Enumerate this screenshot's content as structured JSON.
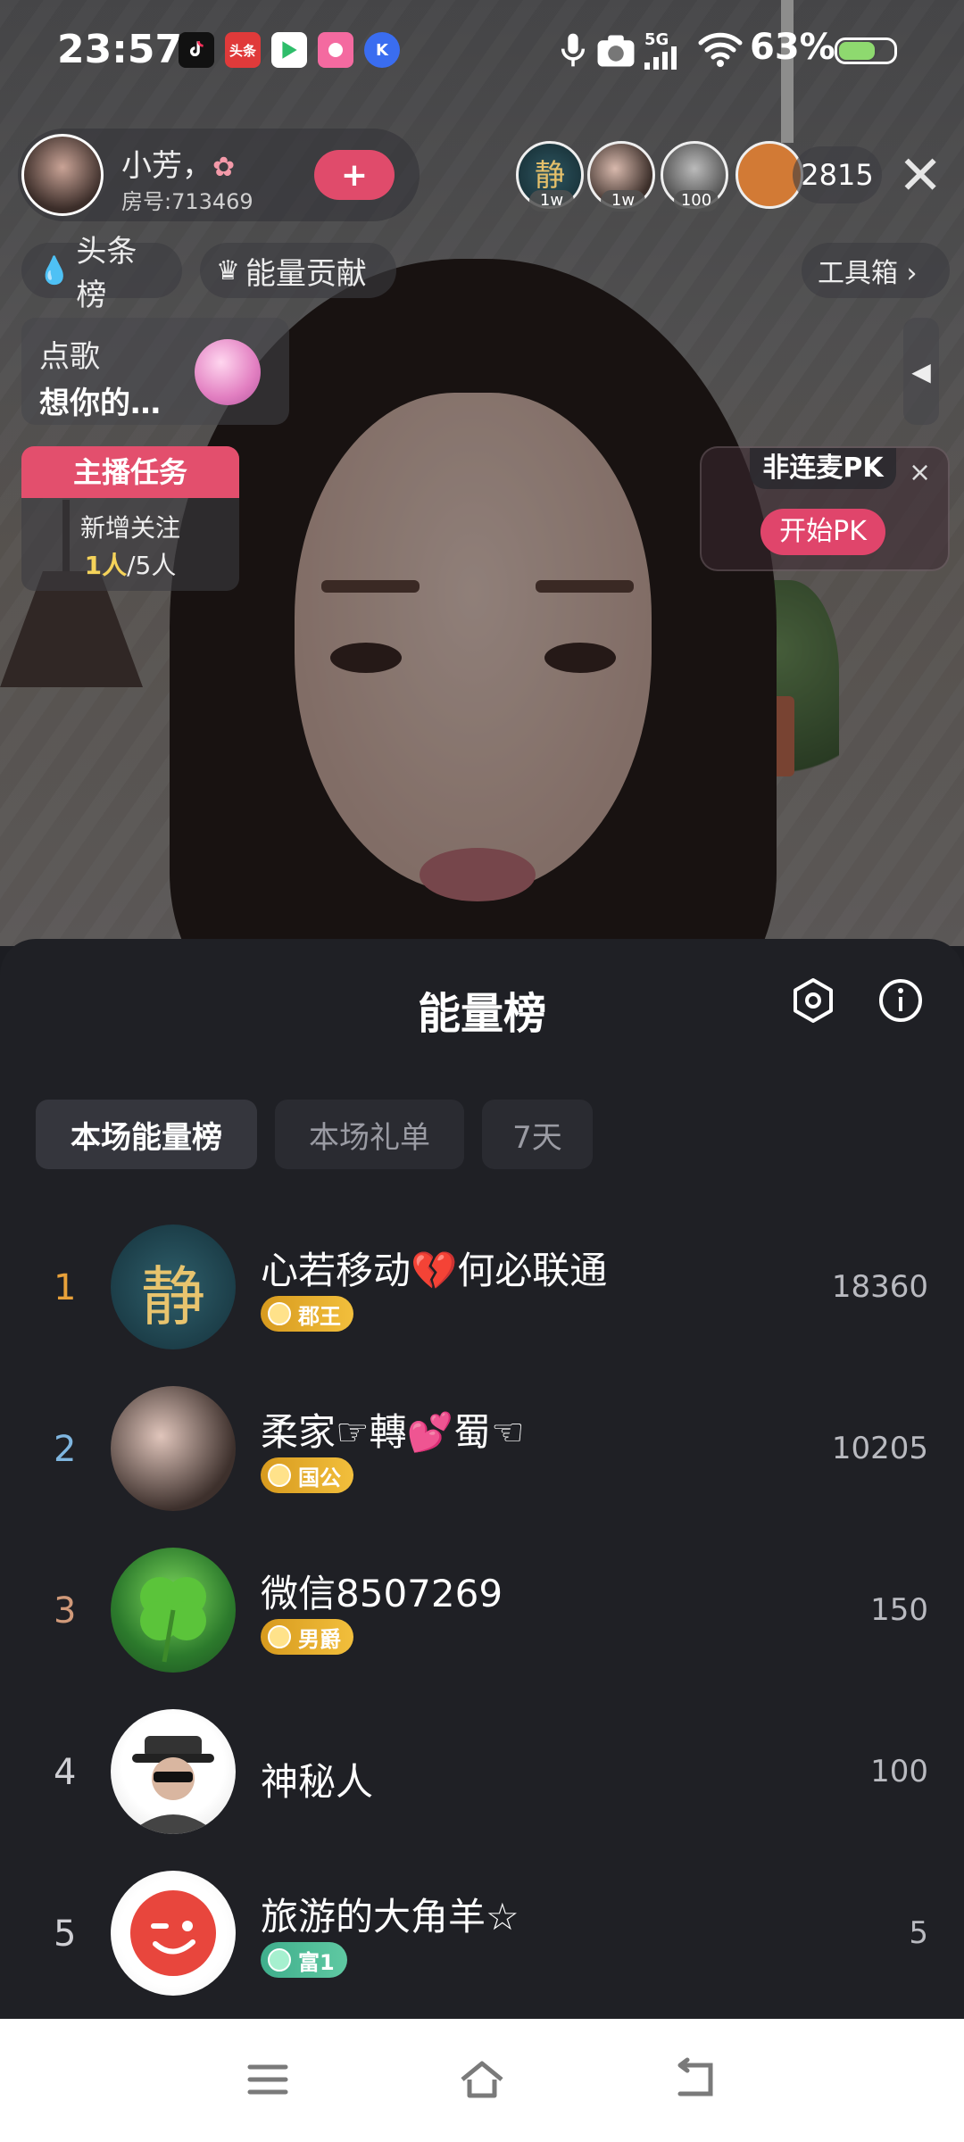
{
  "status": {
    "time": "23:57",
    "battery": "63%",
    "battery_level": 0.63,
    "apps": [
      "tiktok-icon",
      "toutiao-icon",
      "play-icon",
      "app-icon",
      "kuaishou-icon"
    ],
    "app_toutiao_label": "头条",
    "app_k_label": "K",
    "network": "5G"
  },
  "host": {
    "name": "小芳，",
    "room_id": "房号:713469",
    "follow_label": "+"
  },
  "viewers": {
    "tags": [
      "1w",
      "1w",
      "100"
    ],
    "count": "2815",
    "first_avatar_char": "静"
  },
  "toolbar": {
    "headline": "头条榜",
    "energy": "能量贡献",
    "toolbox": "工具箱 ›"
  },
  "song": {
    "label": "点歌",
    "title": "想你的…"
  },
  "task": {
    "title": "主播任务",
    "desc": "新增关注",
    "done": "1人",
    "total": "/5人"
  },
  "pk": {
    "tag": "非连麦PK",
    "button": "开始PK",
    "close": "×"
  },
  "sheet": {
    "title": "能量榜",
    "tabs": [
      "本场能量榜",
      "本场礼单",
      "7天"
    ],
    "rows": [
      {
        "rank": "1",
        "name": "心若移动💔何必联通",
        "badge": "郡王",
        "score": "18360"
      },
      {
        "rank": "2",
        "name": "柔家☞轉💕蜀☜",
        "badge": "国公",
        "score": "10205"
      },
      {
        "rank": "3",
        "name": "微信8507269",
        "badge": "男爵",
        "score": "150"
      },
      {
        "rank": "4",
        "name": "神秘人",
        "badge": "",
        "score": "100"
      },
      {
        "rank": "5",
        "name": "旅游的大角羊☆",
        "badge": "富1",
        "score": "5"
      }
    ],
    "rank_colors": [
      "#e8a13a",
      "#7fb6e0",
      "#d19a7a",
      "#cfcfd4",
      "#cfcfd4"
    ],
    "avatar_chars": [
      "静",
      "",
      "",
      "",
      ""
    ]
  }
}
